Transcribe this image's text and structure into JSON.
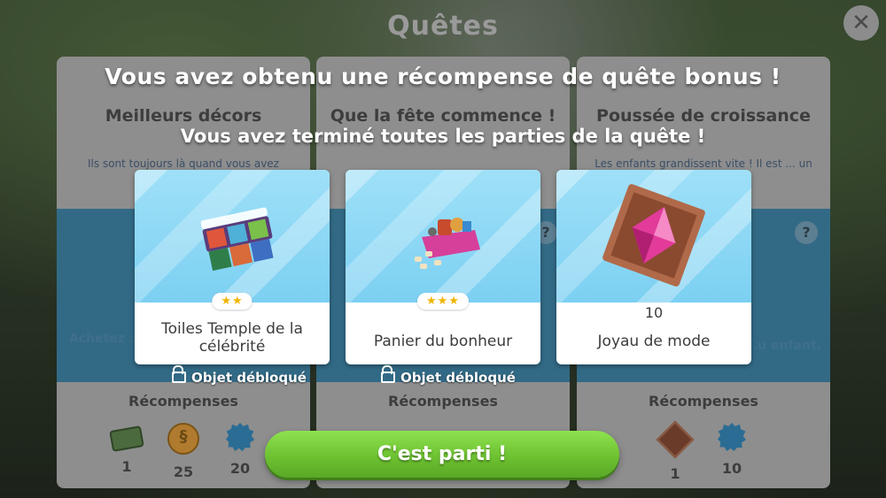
{
  "screen": {
    "title": "Quêtes",
    "close_icon": "close-icon"
  },
  "quests": [
    {
      "title": "Meilleurs décors",
      "description": "Ils sont toujours là quand vous avez besoin de",
      "task": "Achetez ... mur p...",
      "rewards_title": "Récompenses",
      "rewards": [
        {
          "icon": "money-bundle-icon",
          "count": "1"
        },
        {
          "icon": "simoleon-coin-icon",
          "count": "25"
        },
        {
          "icon": "blue-badge-icon",
          "count": "20"
        }
      ]
    },
    {
      "title": "Que la fête commence !",
      "description": "",
      "task": "",
      "rewards_title": "Récompenses",
      "rewards": []
    },
    {
      "title": "Poussée de croissance",
      "description": "Les enfants grandissent vite ! Il est ... un nouveau",
      "task": "...u enfant.",
      "rewards_title": "Récompenses",
      "rewards": [
        {
          "icon": "style-gem-icon",
          "count": "1"
        },
        {
          "icon": "blue-badge-icon",
          "count": "10"
        }
      ]
    }
  ],
  "popup": {
    "headline": "Vous avez obtenu une récompense de quête bonus !",
    "subline": "Vous avez terminé toutes les parties de la quête !",
    "cards": [
      {
        "label": "Toiles Temple de la célébrité",
        "stars": "★★",
        "unlock": "Objet débloqué",
        "icon": "canvas-paintings-icon"
      },
      {
        "label": "Panier du bonheur",
        "stars": "★★★",
        "unlock": "Objet débloqué",
        "icon": "toy-basket-icon"
      },
      {
        "label": "Joyau de mode",
        "quantity": "10",
        "icon": "pink-gem-icon"
      }
    ],
    "go_button": "C'est parti !"
  }
}
